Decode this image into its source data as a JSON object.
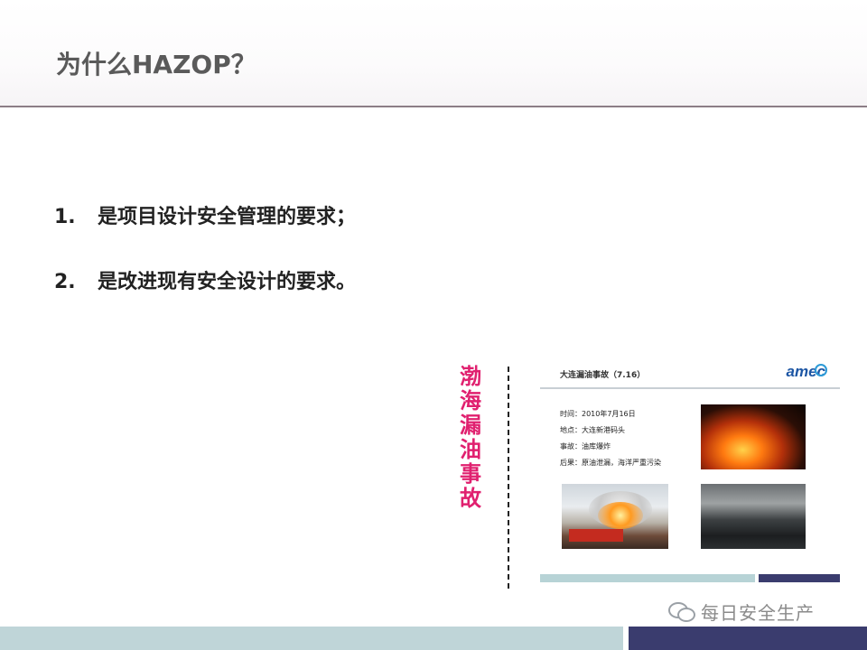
{
  "header": {
    "title": "为什么HAZOP？"
  },
  "list": {
    "items": [
      {
        "number": "1.",
        "text": "是项目设计安全管理的要求；"
      },
      {
        "number": "2.",
        "text": "是改进现有安全设计的要求。"
      }
    ]
  },
  "side_caption": [
    "渤",
    "海",
    "漏",
    "油",
    "事",
    "故"
  ],
  "embedded_slide": {
    "title": "大连漏油事故（7.16）",
    "logo": "amec",
    "facts": [
      "时间：2010年7月16日",
      "地点：大连新港码头",
      "事故：油库爆炸",
      "后果：原油泄漏，海洋严重污染"
    ]
  },
  "watermark": {
    "text": "每日安全生产"
  },
  "colors": {
    "accent_pink": "#e0206f",
    "footer_light": "#bfd5d8",
    "footer_dark": "#3a3c6e",
    "title_gray": "#5a5a5a"
  }
}
